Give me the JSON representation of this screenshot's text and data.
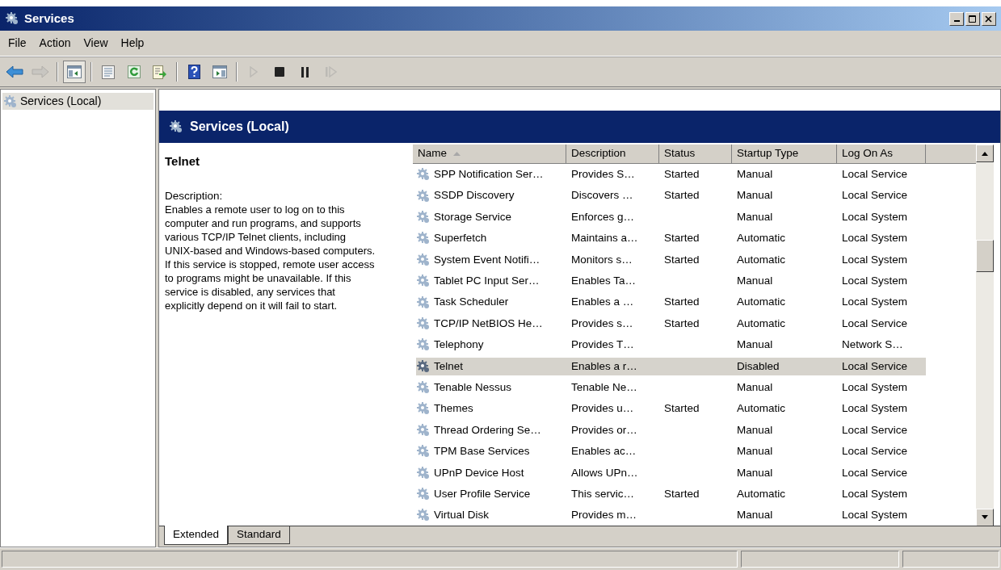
{
  "window": {
    "title": "Services"
  },
  "menu": [
    "File",
    "Action",
    "View",
    "Help"
  ],
  "toolbar": [
    {
      "kind": "back",
      "disabled": false
    },
    {
      "kind": "forward",
      "disabled": true
    },
    {
      "kind": "separator"
    },
    {
      "kind": "console-tree",
      "disabled": false,
      "pressed": true
    },
    {
      "kind": "separator"
    },
    {
      "kind": "properties",
      "disabled": false
    },
    {
      "kind": "refresh",
      "disabled": false
    },
    {
      "kind": "export",
      "disabled": false
    },
    {
      "kind": "separator"
    },
    {
      "kind": "help",
      "disabled": false
    },
    {
      "kind": "action-pane",
      "disabled": false
    },
    {
      "kind": "separator"
    },
    {
      "kind": "play",
      "disabled": true
    },
    {
      "kind": "stop",
      "disabled": false
    },
    {
      "kind": "pause",
      "disabled": false
    },
    {
      "kind": "resume",
      "disabled": true
    }
  ],
  "tree": {
    "items": [
      {
        "label": "Services (Local)",
        "selected": true
      }
    ]
  },
  "pane": {
    "title": "Services (Local)"
  },
  "details": {
    "service_name": "Telnet",
    "label": "Description:",
    "text": "Enables a remote user to log on to this computer and run programs, and supports various TCP/IP Telnet clients, including UNIX-based and Windows-based computers. If this service is stopped, remote user access to programs might be unavailable. If this service is disabled, any services that explicitly depend on it will fail to start."
  },
  "table": {
    "columns": [
      "Name",
      "Description",
      "Status",
      "Startup Type",
      "Log On As"
    ],
    "rows": [
      {
        "name": "SPP Notification Ser…",
        "description": "Provides S…",
        "status": "Started",
        "startup_type": "Manual",
        "log_on_as": "Local Service",
        "selected": false
      },
      {
        "name": "SSDP Discovery",
        "description": "Discovers …",
        "status": "Started",
        "startup_type": "Manual",
        "log_on_as": "Local Service",
        "selected": false
      },
      {
        "name": "Storage Service",
        "description": "Enforces g…",
        "status": "",
        "startup_type": "Manual",
        "log_on_as": "Local System",
        "selected": false
      },
      {
        "name": "Superfetch",
        "description": "Maintains a…",
        "status": "Started",
        "startup_type": "Automatic",
        "log_on_as": "Local System",
        "selected": false
      },
      {
        "name": "System Event Notifi…",
        "description": "Monitors s…",
        "status": "Started",
        "startup_type": "Automatic",
        "log_on_as": "Local System",
        "selected": false
      },
      {
        "name": "Tablet PC Input Ser…",
        "description": "Enables Ta…",
        "status": "",
        "startup_type": "Manual",
        "log_on_as": "Local System",
        "selected": false
      },
      {
        "name": "Task Scheduler",
        "description": "Enables a …",
        "status": "Started",
        "startup_type": "Automatic",
        "log_on_as": "Local System",
        "selected": false
      },
      {
        "name": "TCP/IP NetBIOS He…",
        "description": "Provides s…",
        "status": "Started",
        "startup_type": "Automatic",
        "log_on_as": "Local Service",
        "selected": false
      },
      {
        "name": "Telephony",
        "description": "Provides T…",
        "status": "",
        "startup_type": "Manual",
        "log_on_as": "Network S…",
        "selected": false
      },
      {
        "name": "Telnet",
        "description": "Enables a r…",
        "status": "",
        "startup_type": "Disabled",
        "log_on_as": "Local Service",
        "selected": true
      },
      {
        "name": "Tenable Nessus",
        "description": "Tenable Ne…",
        "status": "",
        "startup_type": "Manual",
        "log_on_as": "Local System",
        "selected": false
      },
      {
        "name": "Themes",
        "description": "Provides u…",
        "status": "Started",
        "startup_type": "Automatic",
        "log_on_as": "Local System",
        "selected": false
      },
      {
        "name": "Thread Ordering Se…",
        "description": "Provides or…",
        "status": "",
        "startup_type": "Manual",
        "log_on_as": "Local Service",
        "selected": false
      },
      {
        "name": "TPM Base Services",
        "description": "Enables ac…",
        "status": "",
        "startup_type": "Manual",
        "log_on_as": "Local Service",
        "selected": false
      },
      {
        "name": "UPnP Device Host",
        "description": "Allows UPn…",
        "status": "",
        "startup_type": "Manual",
        "log_on_as": "Local Service",
        "selected": false
      },
      {
        "name": "User Profile Service",
        "description": "This servic…",
        "status": "Started",
        "startup_type": "Automatic",
        "log_on_as": "Local System",
        "selected": false
      },
      {
        "name": "Virtual Disk",
        "description": "Provides m…",
        "status": "",
        "startup_type": "Manual",
        "log_on_as": "Local System",
        "selected": false
      }
    ]
  },
  "tabs": [
    {
      "label": "Extended",
      "selected": true
    },
    {
      "label": "Standard",
      "selected": false
    }
  ]
}
